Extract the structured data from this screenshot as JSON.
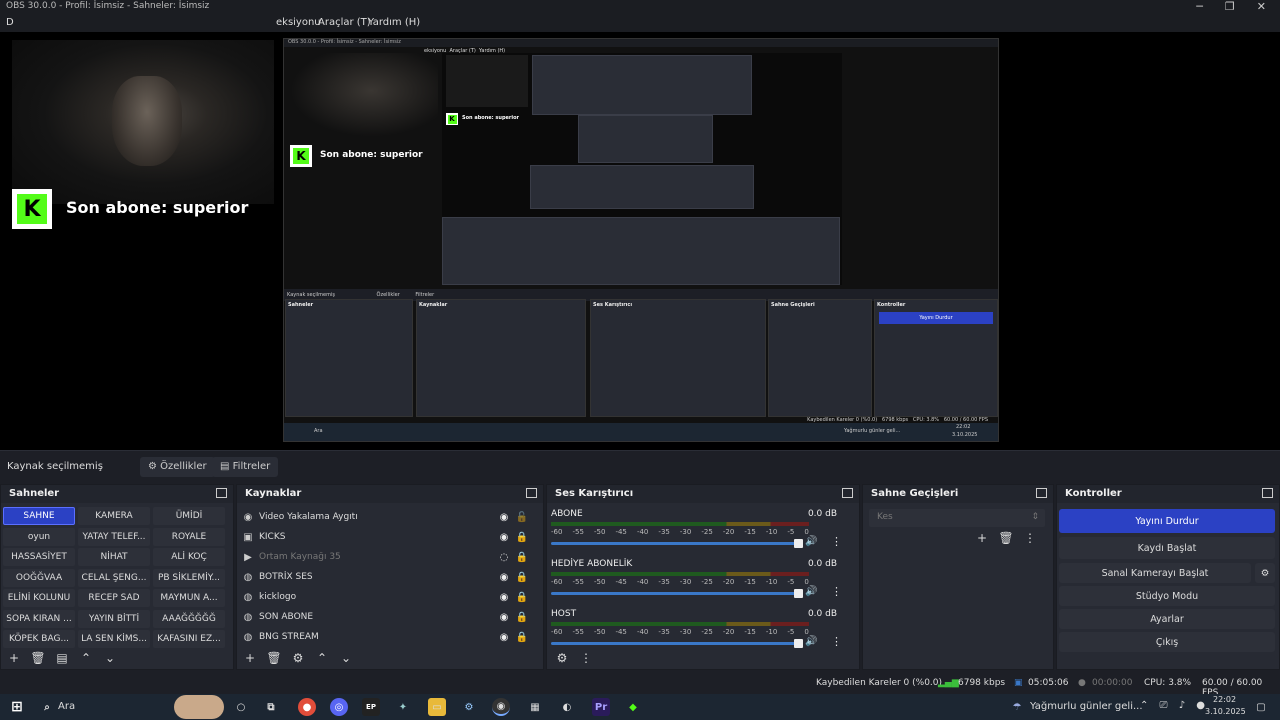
{
  "window": {
    "title": "OBS 30.0.0 - Profil: İsimsiz - Sahneler: İsimsiz",
    "minimize": "─",
    "restore": "❐",
    "close": "✕"
  },
  "menu": {
    "partial": "D",
    "items": [
      "eksiyonu",
      "Araçlar (T)",
      "Yardım (H)"
    ]
  },
  "overlay": {
    "kick_letter": "K",
    "follower_text": "Son abone: superior"
  },
  "nested_obs": {
    "title": "OBS 30.0.0 - Profil: İsimsiz - Sahneler: İsimsiz",
    "menu": [
      "eksiyonu",
      "Araçlar (T)",
      "Yardım (H)"
    ],
    "docks": [
      "Sahneler",
      "Kaynaklar",
      "Ses Karıştırıcı",
      "Sahne Geçişleri",
      "Kontroller"
    ],
    "stop_stream": "Yayını Durdur",
    "dropped": "Kaybedilen Kareler 0 (%0.0)",
    "bitrate": "6798 kbps",
    "cpu": "CPU: 3.8%",
    "fps": "60.00 / 60.00 FPS",
    "time": "22:02",
    "date": "3.10.2025",
    "weather": "Yağmurlu günler geli...",
    "search": "Ara",
    "no_source": "Kaynak seçilmemiş",
    "props": "Özellikler",
    "filters": "Filtreler"
  },
  "source_bar": {
    "label": "Kaynak seçilmemiş",
    "properties": "Özellikler",
    "filters": "Filtreler"
  },
  "scenes": {
    "title": "Sahneler",
    "items": [
      "SAHNE",
      "KAMERA",
      "ÜMİDİ",
      "oyun",
      "YATAY TELEF...",
      "ROYALE",
      "HASSASİYET",
      "NİHAT",
      "ALİ KOÇ",
      "OOĞĞVAA",
      "CELAL ŞENG...",
      "PB SİKLEMİY...",
      "ELİNİ KOLUNU",
      "RECEP SAD",
      "MAYMUN A...",
      "SOPA KIRAN ...",
      "YAYIN BİTTİ",
      "AAAĞĞĞĞĞ",
      "KÖPEK BAG...",
      "LA SEN KİMS...",
      "KAFASINI EZ..."
    ],
    "selected": "SAHNE"
  },
  "sources": {
    "title": "Kaynaklar",
    "items": [
      {
        "icon": "camera",
        "name": "Video Yakalama Aygıtı",
        "hidden": false,
        "locked": false
      },
      {
        "icon": "capture",
        "name": "KICKS",
        "hidden": false,
        "locked": true
      },
      {
        "icon": "media",
        "name": "Ortam Kaynağı 35",
        "hidden": true,
        "locked": true
      },
      {
        "icon": "browser",
        "name": "BOTRİX SES",
        "hidden": false,
        "locked": true
      },
      {
        "icon": "browser",
        "name": "kicklogo",
        "hidden": false,
        "locked": true
      },
      {
        "icon": "browser",
        "name": "SON ABONE",
        "hidden": false,
        "locked": true
      },
      {
        "icon": "browser",
        "name": "BNG STREAM",
        "hidden": false,
        "locked": true
      }
    ]
  },
  "mixer": {
    "title": "Ses Karıştırıcı",
    "scale": [
      "-60",
      "-55",
      "-50",
      "-45",
      "-40",
      "-35",
      "-30",
      "-25",
      "-20",
      "-15",
      "-10",
      "-5",
      "0"
    ],
    "channels": [
      {
        "name": "ABONE",
        "db": "0.0 dB",
        "volume": 1.0
      },
      {
        "name": "HEDİYE ABONELİK",
        "db": "0.0 dB",
        "volume": 1.0
      },
      {
        "name": "HOST",
        "db": "0.0 dB",
        "volume": 1.0
      }
    ]
  },
  "transitions": {
    "title": "Sahne Geçişleri",
    "selected": "Kes"
  },
  "controls": {
    "title": "Kontroller",
    "buttons": [
      "Yayını Durdur",
      "Kaydı Başlat",
      "Sanal Kamerayı Başlat",
      "Stüdyo Modu",
      "Ayarlar",
      "Çıkış"
    ]
  },
  "status": {
    "dropped": "Kaybedilen Kareler 0 (%0.0)",
    "bitrate": "6798 kbps",
    "stream_time": "05:05:06",
    "record_time": "00:00:00",
    "cpu": "CPU: 3.8%",
    "fps": "60.00 / 60.00 FPS"
  },
  "taskbar": {
    "search": "Ara",
    "weather": "Yağmurlu günler geli...",
    "time": "22:02",
    "date": "3.10.2025"
  },
  "colors": {
    "accent": "#2b41c4",
    "kick_green": "#53fc18",
    "panel": "#272a33"
  }
}
